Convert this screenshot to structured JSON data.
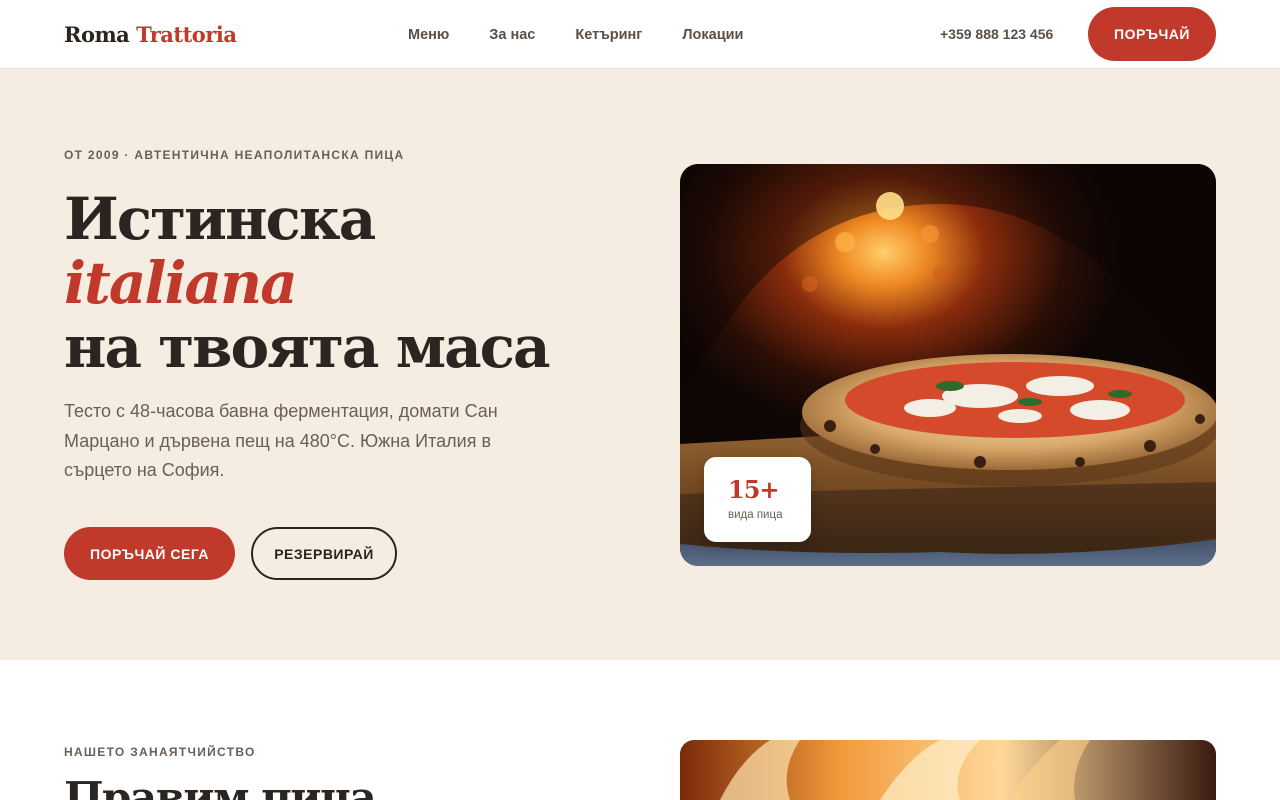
{
  "brand": {
    "name_part1": "Roma",
    "name_part2": "Trattoria"
  },
  "nav": {
    "links": [
      "Меню",
      "За нас",
      "Кетъринг",
      "Локации"
    ],
    "phone": "+359 888 123 456",
    "order_label": "ПОРЪЧАЙ"
  },
  "hero": {
    "eyebrow": "ОТ 2009 · АВТЕНТИЧНА НЕАПОЛИТАНСКА ПИЦА",
    "title_line1": "Истинска",
    "title_line2": "italiana",
    "title_line3": "на твоята маса",
    "lead": "Тесто с 48-часова бавна ферментация, домати Сан Марцано и дървена пещ на 480°C. Южна Италия в сърцето на София.",
    "primary_cta": "ПОРЪЧАЙ СЕГА",
    "secondary_cta": "РЕЗЕРВИРАЙ",
    "badge": {
      "number": "15+",
      "label": "вида пица"
    }
  },
  "craft": {
    "eyebrow": "НАШЕТО ЗАНАЯТЧИЙСТВО",
    "title": "Правим пица"
  },
  "colors": {
    "accent": "#c0392b",
    "hero_bg": "#f5ede1",
    "text_dark": "#2a2521",
    "text_muted": "#6b5f55"
  }
}
